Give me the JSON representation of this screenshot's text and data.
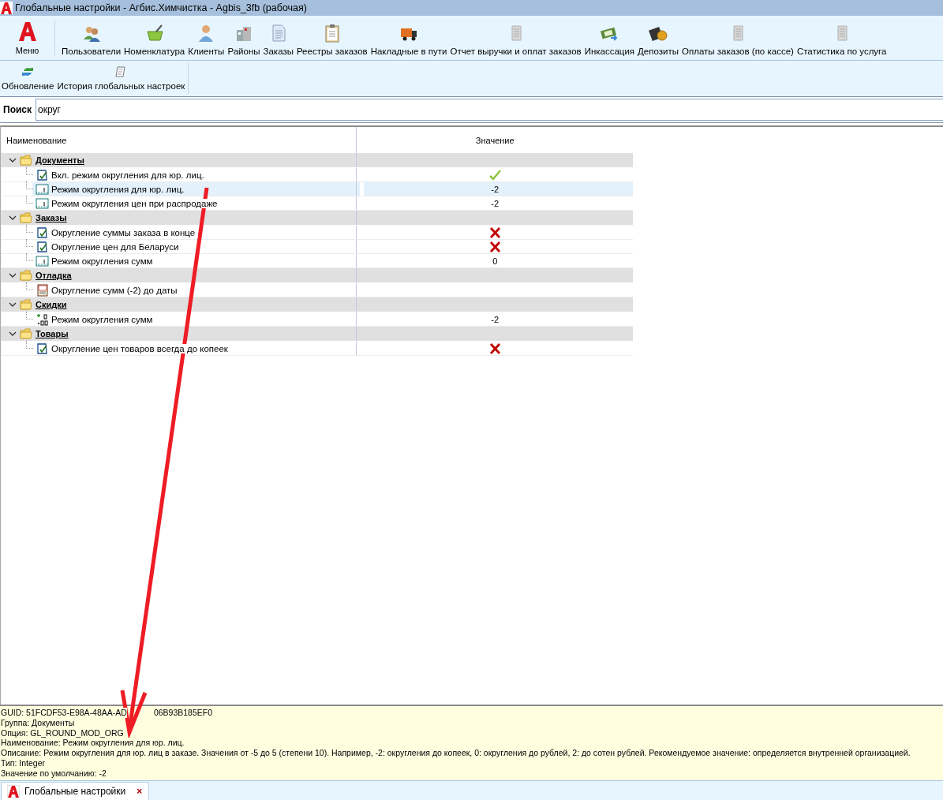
{
  "window": {
    "title": "Глобальные настройки - Агбис.Химчистка - Agbis_3fb (рабочая)"
  },
  "toolbar": {
    "menu_label": "Меню",
    "items": [
      {
        "label": "Пользователи",
        "kind": "users"
      },
      {
        "label": "Номенклатура",
        "kind": "basket"
      },
      {
        "label": "Клиенты",
        "kind": "person"
      },
      {
        "label": "Районы",
        "kind": "buildings"
      },
      {
        "label": "Заказы",
        "kind": "document"
      },
      {
        "label": "Реестры заказов",
        "kind": "clipboard"
      },
      {
        "label": "Накладные в пути",
        "kind": "truck"
      },
      {
        "label": "Отчет выручки и оплат заказов",
        "kind": "report"
      },
      {
        "label": "Инкассация",
        "kind": "money"
      },
      {
        "label": "Депозиты",
        "kind": "wallet"
      },
      {
        "label": "Оплаты заказов (по кассе)",
        "kind": "report"
      },
      {
        "label": "Статистика по услуга",
        "kind": "report"
      }
    ]
  },
  "subtoolbar": {
    "items": [
      {
        "label": "Обновление",
        "kind": "refresh"
      },
      {
        "label": "История глобальных настроек",
        "kind": "scroll"
      }
    ]
  },
  "search": {
    "label": "Поиск",
    "value": "округ"
  },
  "table": {
    "columns": [
      "Наименование",
      "Значение"
    ],
    "groups": [
      {
        "label": "Документы",
        "expanded": true,
        "children": [
          {
            "label": "Вкл. режим округления для юр. лиц.",
            "kind": "flag",
            "checked": true,
            "selected": false
          },
          {
            "label": "Режим округления для юр. лиц.",
            "kind": "integer",
            "value": "-2",
            "selected": true
          },
          {
            "label": "Режим округления цен при распродаже",
            "kind": "integer",
            "value": "-2",
            "selected": false
          }
        ]
      },
      {
        "label": "Заказы",
        "expanded": true,
        "children": [
          {
            "label": "Округление суммы заказа в конце",
            "kind": "flag",
            "checked": false,
            "selected": false
          },
          {
            "label": "Округление цен для Беларуси",
            "kind": "flag",
            "checked": false,
            "selected": false
          },
          {
            "label": "Режим округления сумм",
            "kind": "integer",
            "value": "0",
            "selected": false
          }
        ]
      },
      {
        "label": "Отладка",
        "expanded": true,
        "children": [
          {
            "label": "Округление сумм (-2) до даты",
            "kind": "date",
            "selected": false
          }
        ]
      },
      {
        "label": "Скидки",
        "expanded": true,
        "children": [
          {
            "label": "Режим округления сумм",
            "kind": "decimal",
            "value": "-2",
            "selected": false
          }
        ]
      },
      {
        "label": "Товары",
        "expanded": true,
        "children": [
          {
            "label": "Округление цен товаров всегда до копеек",
            "kind": "flag",
            "checked": false,
            "selected": false
          }
        ]
      }
    ]
  },
  "info": {
    "guid_parts": [
      "GUID: 51FCDF53-E98A-48AA-AD",
      "06B93B185EF0"
    ],
    "lines": [
      "Группа: Документы",
      "Опция: GL_ROUND_MOD_ORG",
      "Наименование: Режим округления для юр. лиц.",
      "Описание: Режим округления для юр. лиц в заказе. Значения от -5 до 5 (степени 10). Например, -2: округления до копеек, 0: округления до рублей, 2: до сотен рублей. Рекомендуемое значение: определяется внутренней организацией.",
      "Тип: Integer",
      "Значение по умолчанию: -2"
    ]
  },
  "tabs": [
    {
      "label": "Глобальные настройки",
      "selected": true,
      "close": "×"
    }
  ]
}
